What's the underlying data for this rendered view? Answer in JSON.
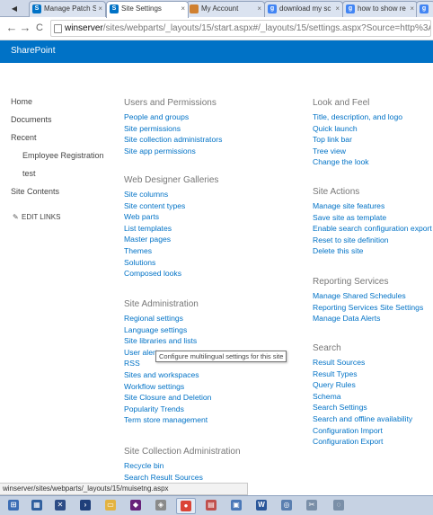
{
  "browser": {
    "back_glyph": "◀",
    "tabs": [
      {
        "label": "Manage Patch S",
        "icon": "sharepoint-icon",
        "color": "#0072c6",
        "glyph": "S"
      },
      {
        "label": "Site Settings",
        "icon": "sharepoint-icon",
        "color": "#0072c6",
        "glyph": "S"
      },
      {
        "label": "My Account",
        "icon": "page-icon",
        "color": "#d08030",
        "glyph": ""
      },
      {
        "label": "download my sc",
        "icon": "google-icon",
        "color": "#4285f4",
        "glyph": "g"
      },
      {
        "label": "how to show re",
        "icon": "google-icon",
        "color": "#4285f4",
        "glyph": "g"
      },
      {
        "label": "",
        "icon": "google-icon",
        "color": "#4285f4",
        "glyph": "g"
      }
    ],
    "active_tab": 1,
    "close_glyph": "×",
    "back_button": "←",
    "forward_button": "→",
    "reload_button": "C",
    "url_host": "winserver",
    "url_rest": "/sites/webparts/_layouts/15/start.aspx#/_layouts/15/settings.aspx?Source=http%3A%"
  },
  "suite_bar": {
    "brand": "SharePoint",
    "color": "#0072c6"
  },
  "quick_launch": {
    "items": [
      "Home",
      "Documents",
      "Recent",
      "Employee Registration",
      "test",
      "Site Contents"
    ],
    "edit_links": "EDIT LINKS"
  },
  "groups": [
    {
      "heading": "Users and Permissions",
      "links": [
        "People and groups",
        "Site permissions",
        "Site collection administrators",
        "Site app permissions"
      ]
    },
    {
      "heading": "Web Designer Galleries",
      "links": [
        "Site columns",
        "Site content types",
        "Web parts",
        "List templates",
        "Master pages",
        "Themes",
        "Solutions",
        "Composed looks"
      ]
    },
    {
      "heading": "Site Administration",
      "links": [
        "Regional settings",
        "Language settings",
        "Site libraries and lists",
        "User alerts",
        "RSS",
        "Sites and workspaces",
        "Workflow settings",
        "Site Closure and Deletion",
        "Popularity Trends",
        "Term store management"
      ]
    },
    {
      "heading": "Site Collection Administration",
      "links": [
        "Recycle bin",
        "Search Result Sources"
      ]
    },
    {
      "heading": "Look and Feel",
      "links": [
        "Title, description, and logo",
        "Quick launch",
        "Top link bar",
        "Tree view",
        "Change the look"
      ]
    },
    {
      "heading": "Site Actions",
      "links": [
        "Manage site features",
        "Save site as template",
        "Enable search configuration export",
        "Reset to site definition",
        "Delete this site"
      ]
    },
    {
      "heading": "Reporting Services",
      "links": [
        "Manage Shared Schedules",
        "Reporting Services Site Settings",
        "Manage Data Alerts"
      ]
    },
    {
      "heading": "Search",
      "links": [
        "Result Sources",
        "Result Types",
        "Query Rules",
        "Schema",
        "Search Settings",
        "Search and offline availability",
        "Configuration Import",
        "Configuration Export"
      ]
    }
  ],
  "tooltip": "Configure multilingual settings for this site",
  "status_bar": "winserver/sites/webparts/_layouts/15/muisetng.aspx",
  "taskbar": {
    "items": [
      {
        "icon": "start-icon",
        "glyph": "⊞",
        "color": "#3b6db5"
      },
      {
        "icon": "server-manager-icon",
        "glyph": "▦",
        "color": "#2f5f9e"
      },
      {
        "icon": "tools-icon",
        "glyph": "✕",
        "color": "#2c4c86"
      },
      {
        "icon": "powershell-icon",
        "glyph": "›",
        "color": "#1f3f7a"
      },
      {
        "icon": "folder-icon",
        "glyph": "▭",
        "color": "#e3b341"
      },
      {
        "icon": "visual-studio-icon",
        "glyph": "◆",
        "color": "#68217a"
      },
      {
        "icon": "sql-icon",
        "glyph": "◈",
        "color": "#8a8a8a"
      },
      {
        "icon": "chrome-icon",
        "glyph": "●",
        "color": "#db4437"
      },
      {
        "icon": "paint-icon",
        "glyph": "▤",
        "color": "#c0504d"
      },
      {
        "icon": "image-icon",
        "glyph": "▣",
        "color": "#4a78b8"
      },
      {
        "icon": "word-icon",
        "glyph": "W",
        "color": "#2b579a"
      },
      {
        "icon": "app-icon",
        "glyph": "◎",
        "color": "#5a7fb0"
      },
      {
        "icon": "snipping-icon",
        "glyph": "✂",
        "color": "#7a8fa8"
      },
      {
        "icon": "search-icon",
        "glyph": "◌",
        "color": "#7a8fa8"
      }
    ]
  }
}
